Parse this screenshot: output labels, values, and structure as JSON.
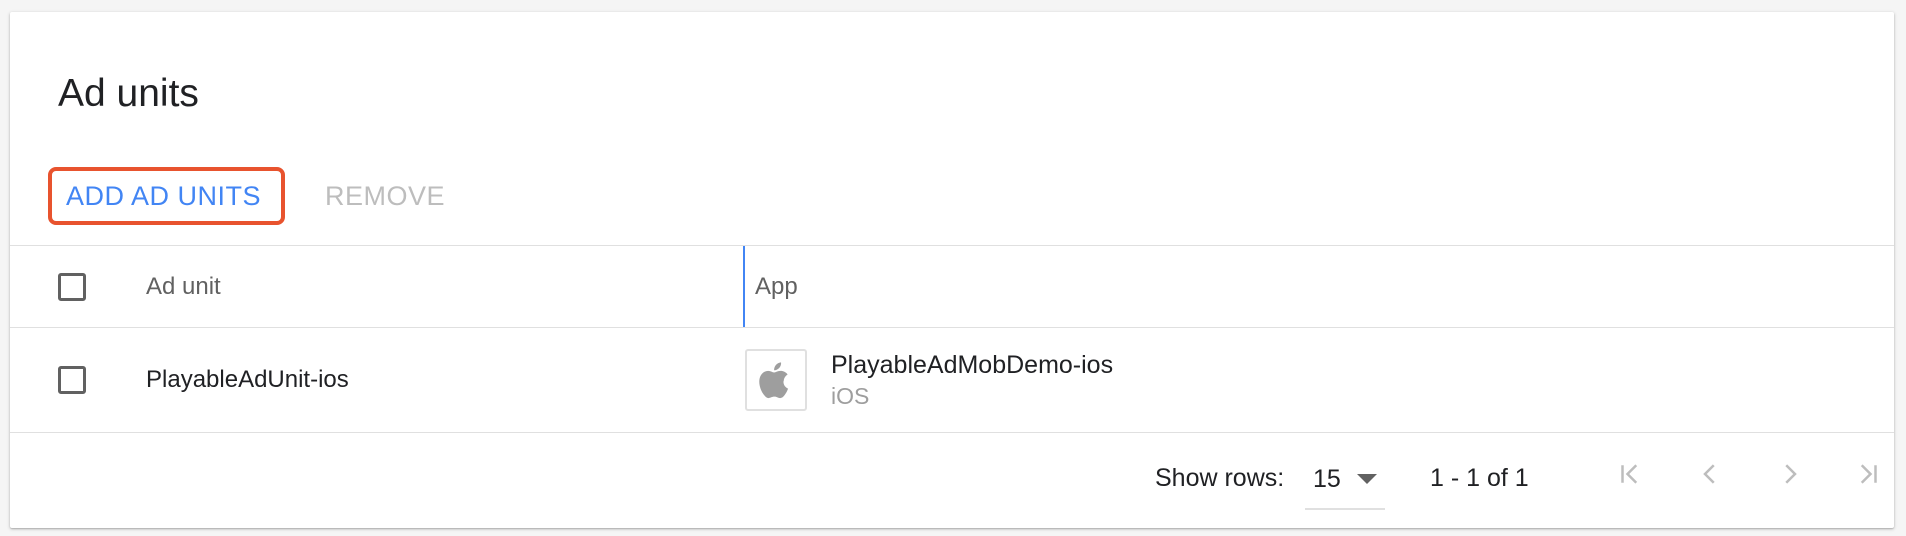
{
  "card": {
    "title": "Ad units"
  },
  "toolbar": {
    "add_label": "ADD AD UNITS",
    "remove_label": "REMOVE"
  },
  "table": {
    "columns": [
      "Ad unit",
      "App"
    ],
    "rows": [
      {
        "ad_unit": "PlayableAdUnit-ios",
        "app_name": "PlayableAdMobDemo-ios",
        "app_platform": "iOS",
        "app_icon": "apple-icon"
      }
    ]
  },
  "pagination": {
    "show_rows_label": "Show rows:",
    "rows_per_page": "15",
    "range_text": "1 - 1 of 1"
  },
  "colors": {
    "accent": "#4285f4",
    "highlight_border": "#e8532e",
    "disabled_text": "#bdbdbd"
  }
}
